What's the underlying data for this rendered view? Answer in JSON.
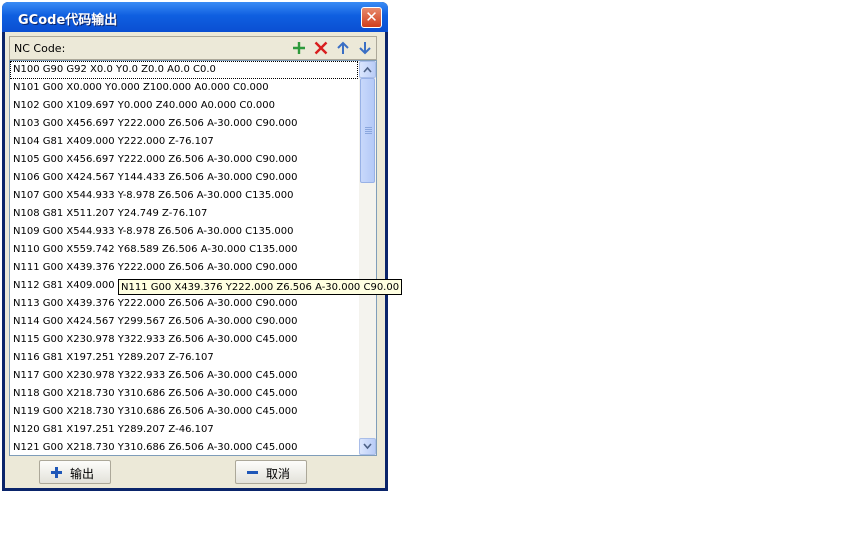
{
  "window": {
    "title": "GCode代码输出",
    "close_glyph": "✕"
  },
  "toolbar": {
    "label": "NC Code:",
    "icons": [
      "add-icon",
      "delete-icon",
      "move-up-icon",
      "move-down-icon"
    ],
    "colors": {
      "add": "#2e9a3c",
      "delete": "#d81e1e",
      "arrows": "#3a6fc4"
    }
  },
  "code_lines": [
    "N100 G90 G92 X0.0 Y0.0 Z0.0 A0.0 C0.0",
    "N101 G00 X0.000 Y0.000 Z100.000 A0.000 C0.000",
    "N102 G00 X109.697 Y0.000 Z40.000 A0.000 C0.000",
    "N103 G00 X456.697 Y222.000 Z6.506 A-30.000 C90.000",
    "N104 G81 X409.000 Y222.000 Z-76.107",
    "N105 G00 X456.697 Y222.000 Z6.506 A-30.000 C90.000",
    "N106 G00 X424.567 Y144.433 Z6.506 A-30.000 C90.000",
    "N107 G00 X544.933 Y-8.978 Z6.506 A-30.000 C135.000",
    "N108 G81 X511.207 Y24.749 Z-76.107",
    "N109 G00 X544.933 Y-8.978 Z6.506 A-30.000 C135.000",
    "N110 G00 X559.742 Y68.589 Z6.506 A-30.000 C135.000",
    "N111 G00 X439.376 Y222.000 Z6.506 A-30.000 C90.000",
    "N112 G81 X409.000 Y222.000 Z-76.107",
    "N113 G00 X439.376 Y222.000 Z6.506 A-30.000 C90.000",
    "N114 G00 X424.567 Y299.567 Z6.506 A-30.000 C90.000",
    "N115 G00 X230.978 Y322.933 Z6.506 A-30.000 C45.000",
    "N116 G81 X197.251 Y289.207 Z-76.107",
    "N117 G00 X230.978 Y322.933 Z6.506 A-30.000 C45.000",
    "N118 G00 X218.730 Y310.686 Z6.506 A-30.000 C45.000",
    "N119 G00 X218.730 Y310.686 Z6.506 A-30.000 C45.000",
    "N120 G81 X197.251 Y289.207 Z-46.107",
    "N121 G00 X218.730 Y310.686 Z6.506 A-30.000 C45.000"
  ],
  "tooltip": "N111 G00 X439.376 Y222.000 Z6.506 A-30.000 C90.00",
  "buttons": {
    "output_label": "输出",
    "cancel_label": "取消"
  }
}
